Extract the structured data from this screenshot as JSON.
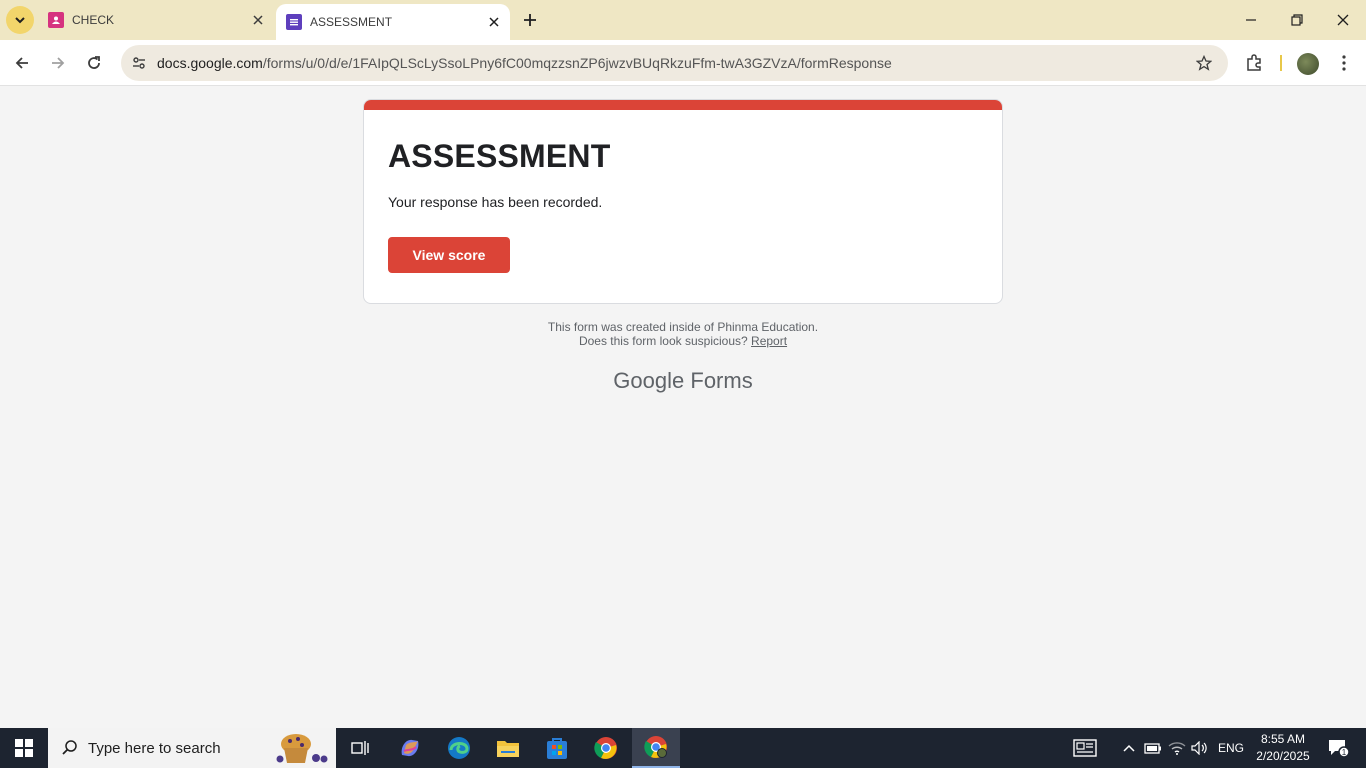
{
  "browser": {
    "tabs": [
      {
        "title": "CHECK",
        "active": false
      },
      {
        "title": "ASSESSMENT",
        "active": true
      }
    ],
    "url_host": "docs.google.com",
    "url_path": "/forms/u/0/d/e/1FAIpQLScLySsoLPny6fC00mqzzsnZP6jwzvBUqRkzuFfm-twA3GZVzA/formResponse"
  },
  "form": {
    "title": "ASSESSMENT",
    "message": "Your response has been recorded.",
    "view_score_label": "View score",
    "accent_color": "#db4437"
  },
  "footer": {
    "created_text": "This form was created inside of Phinma Education.",
    "suspicious_text": "Does this form look suspicious?",
    "report_label": "Report",
    "brand_google": "Google",
    "brand_forms": "Forms"
  },
  "taskbar": {
    "search_placeholder": "Type here to search",
    "language": "ENG",
    "time": "8:55 AM",
    "date": "2/20/2025",
    "notification_count": "1"
  },
  "icons": [
    "tab-search-icon",
    "forms-favicon",
    "contacts-favicon",
    "close-icon",
    "new-tab-icon",
    "minimize-icon",
    "restore-icon",
    "back-icon",
    "forward-icon",
    "reload-icon",
    "site-info-icon",
    "bookmark-star-icon",
    "extensions-icon",
    "kebab-menu-icon",
    "windows-start-icon",
    "search-icon",
    "task-view-icon",
    "copilot-icon",
    "edge-icon",
    "file-explorer-icon",
    "store-icon",
    "chrome-icon",
    "news-icon",
    "chevron-up-icon",
    "battery-icon",
    "wifi-icon",
    "volume-icon",
    "notification-icon"
  ]
}
